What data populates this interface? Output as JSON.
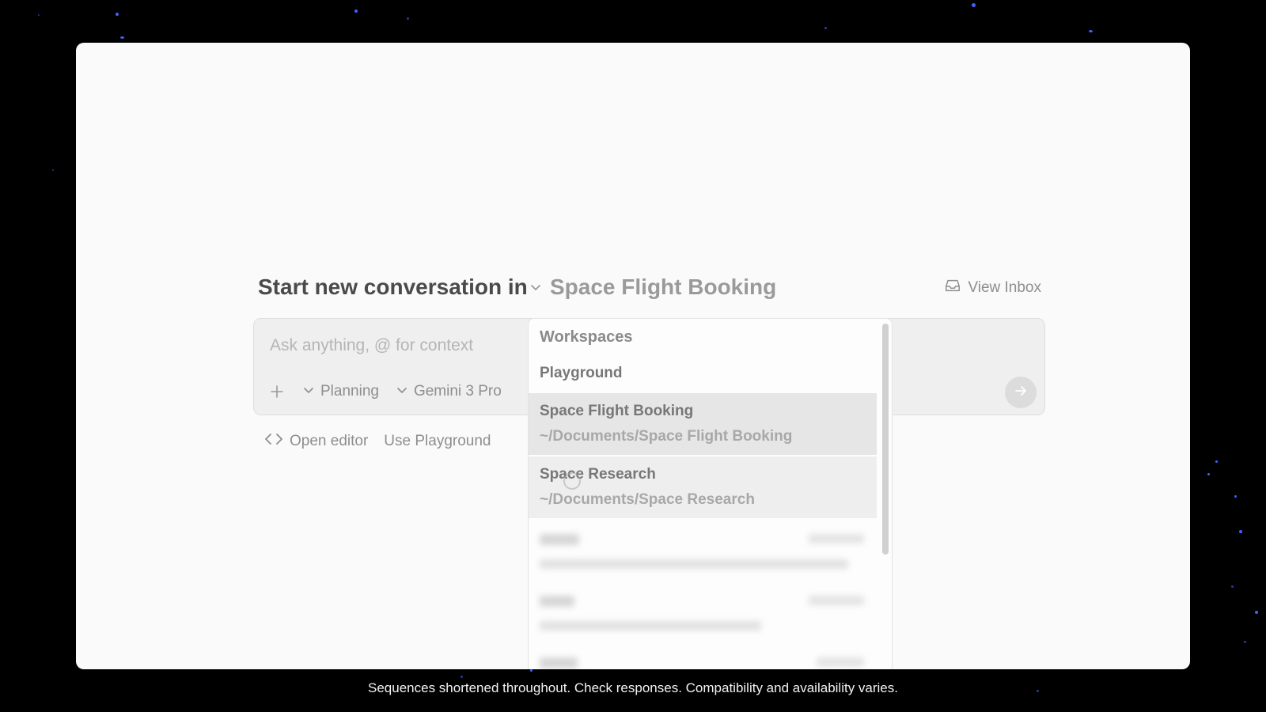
{
  "header": {
    "title_prefix": "Start new conversation in",
    "workspace_name": "Space Flight Booking",
    "view_inbox_label": "View Inbox"
  },
  "composer": {
    "placeholder": "Ask anything, @ for context",
    "mode_label": "Planning",
    "model_label": "Gemini 3 Pro"
  },
  "actions": {
    "open_editor_label": "Open editor",
    "use_playground_label": "Use Playground"
  },
  "workspace_dropdown": {
    "heading": "Workspaces",
    "items": [
      {
        "name": "Playground",
        "path": ""
      },
      {
        "name": "Space Flight Booking",
        "path": "~/Documents/Space Flight Booking",
        "selected": true
      },
      {
        "name": "Space Research",
        "path": "~/Documents/Space Research",
        "hovered": true
      }
    ]
  },
  "caption": "Sequences shortened throughout. Check responses. Compatibility and availability varies.",
  "icons": [
    "chevron-down-icon",
    "inbox-icon",
    "plus-icon",
    "arrow-right-icon",
    "code-icon"
  ],
  "colors": {
    "background": "#000000",
    "window": "#fafafa",
    "accent_star": "#3f63ff"
  }
}
